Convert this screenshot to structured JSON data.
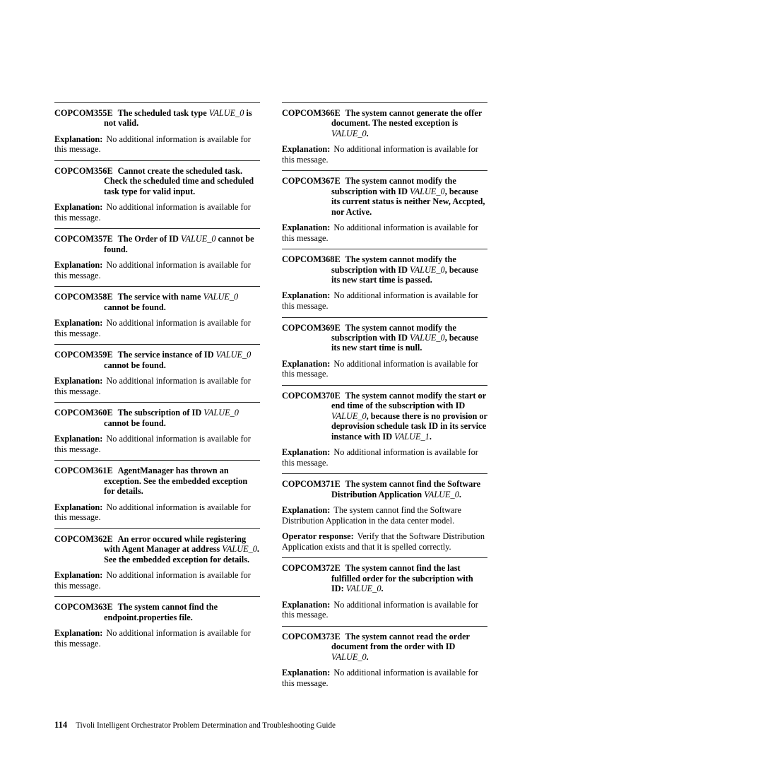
{
  "page": {
    "number": "114",
    "footer_title": "Tivoli Intelligent Orchestrator Problem Determination and Troubleshooting Guide"
  },
  "labels": {
    "explanation": "Explanation:",
    "operator_response": "Operator response:"
  },
  "columns": {
    "left": [
      {
        "id": "COPCOM355E",
        "text_parts": [
          {
            "t": "The scheduled task type ",
            "style": "bold"
          },
          {
            "t": "VALUE_0",
            "style": "var"
          },
          {
            "t": " is not valid.",
            "style": "bold"
          }
        ],
        "blocks": [
          {
            "label": "Explanation:",
            "body": "No additional information is available for this message."
          }
        ]
      },
      {
        "id": "COPCOM356E",
        "text_parts": [
          {
            "t": "Cannot create the scheduled task. Check the scheduled time and scheduled task type for valid input.",
            "style": "bold"
          }
        ],
        "blocks": [
          {
            "label": "Explanation:",
            "body": "No additional information is available for this message."
          }
        ]
      },
      {
        "id": "COPCOM357E",
        "text_parts": [
          {
            "t": "The Order of ID ",
            "style": "bold"
          },
          {
            "t": "VALUE_0",
            "style": "var"
          },
          {
            "t": " cannot be found.",
            "style": "bold"
          }
        ],
        "blocks": [
          {
            "label": "Explanation:",
            "body": "No additional information is available for this message."
          }
        ]
      },
      {
        "id": "COPCOM358E",
        "text_parts": [
          {
            "t": "The service with name ",
            "style": "bold"
          },
          {
            "t": "VALUE_0",
            "style": "var"
          },
          {
            "t": " cannot be found.",
            "style": "bold"
          }
        ],
        "blocks": [
          {
            "label": "Explanation:",
            "body": "No additional information is available for this message."
          }
        ]
      },
      {
        "id": "COPCOM359E",
        "text_parts": [
          {
            "t": "The service instance of ID ",
            "style": "bold"
          },
          {
            "t": "VALUE_0",
            "style": "var"
          },
          {
            "t": " cannot be found.",
            "style": "bold"
          }
        ],
        "blocks": [
          {
            "label": "Explanation:",
            "body": "No additional information is available for this message."
          }
        ]
      },
      {
        "id": "COPCOM360E",
        "text_parts": [
          {
            "t": "The subscription of ID ",
            "style": "bold"
          },
          {
            "t": "VALUE_0",
            "style": "var"
          },
          {
            "t": " cannot be found.",
            "style": "bold"
          }
        ],
        "blocks": [
          {
            "label": "Explanation:",
            "body": "No additional information is available for this message."
          }
        ]
      },
      {
        "id": "COPCOM361E",
        "text_parts": [
          {
            "t": "AgentManager has thrown an exception. See the embedded exception for details.",
            "style": "bold"
          }
        ],
        "blocks": [
          {
            "label": "Explanation:",
            "body": "No additional information is available for this message."
          }
        ]
      },
      {
        "id": "COPCOM362E",
        "text_parts": [
          {
            "t": "An error occured while registering with Agent Manager at address ",
            "style": "bold"
          },
          {
            "t": "VALUE_0",
            "style": "var"
          },
          {
            "t": ". See the embedded exception for details.",
            "style": "bold"
          }
        ],
        "blocks": [
          {
            "label": "Explanation:",
            "body": "No additional information is available for this message."
          }
        ]
      },
      {
        "id": "COPCOM363E",
        "text_parts": [
          {
            "t": "The system cannot find the endpoint.properties file.",
            "style": "bold"
          }
        ],
        "blocks": [
          {
            "label": "Explanation:",
            "body": "No additional information is available for this message."
          }
        ]
      }
    ],
    "right": [
      {
        "id": "COPCOM366E",
        "text_parts": [
          {
            "t": "The system cannot generate the offer document. The nested exception is ",
            "style": "bold"
          },
          {
            "t": "VALUE_0",
            "style": "var"
          },
          {
            "t": ".",
            "style": "bold"
          }
        ],
        "blocks": [
          {
            "label": "Explanation:",
            "body": "No additional information is available for this message."
          }
        ]
      },
      {
        "id": "COPCOM367E",
        "text_parts": [
          {
            "t": "The system cannot modify the subscription with ID ",
            "style": "bold"
          },
          {
            "t": "VALUE_0",
            "style": "var"
          },
          {
            "t": ", because its current status is neither New, Accpted, nor Active.",
            "style": "bold"
          }
        ],
        "blocks": [
          {
            "label": "Explanation:",
            "body": "No additional information is available for this message."
          }
        ]
      },
      {
        "id": "COPCOM368E",
        "text_parts": [
          {
            "t": "The system cannot modify the subscription with ID ",
            "style": "bold"
          },
          {
            "t": "VALUE_0",
            "style": "var"
          },
          {
            "t": ", because its new start time is passed.",
            "style": "bold"
          }
        ],
        "blocks": [
          {
            "label": "Explanation:",
            "body": "No additional information is available for this message."
          }
        ]
      },
      {
        "id": "COPCOM369E",
        "text_parts": [
          {
            "t": "The system cannot modify the subscription with ID ",
            "style": "bold"
          },
          {
            "t": "VALUE_0",
            "style": "var"
          },
          {
            "t": ", because its new start time is null.",
            "style": "bold"
          }
        ],
        "blocks": [
          {
            "label": "Explanation:",
            "body": "No additional information is available for this message."
          }
        ]
      },
      {
        "id": "COPCOM370E",
        "text_parts": [
          {
            "t": "The system cannot modify the start or end time of the subscription with ID ",
            "style": "bold"
          },
          {
            "t": "VALUE_0",
            "style": "var"
          },
          {
            "t": ", because there is no provision or deprovision schedule task ID in its service instance with ID ",
            "style": "bold"
          },
          {
            "t": "VALUE_1",
            "style": "var"
          },
          {
            "t": ".",
            "style": "bold"
          }
        ],
        "blocks": [
          {
            "label": "Explanation:",
            "body": "No additional information is available for this message."
          }
        ]
      },
      {
        "id": "COPCOM371E",
        "text_parts": [
          {
            "t": "The system cannot find the Software Distribution Application ",
            "style": "bold"
          },
          {
            "t": "VALUE_0",
            "style": "var"
          },
          {
            "t": ".",
            "style": "bold"
          }
        ],
        "blocks": [
          {
            "label": "Explanation:",
            "body": "The system cannot find the Software Distribution Application in the data center model."
          },
          {
            "label": "Operator response:",
            "body": "Verify that the Software Distribution Application exists and that it is spelled correctly."
          }
        ]
      },
      {
        "id": "COPCOM372E",
        "text_parts": [
          {
            "t": "The system cannot find the last fulfilled order for the subcription with ID: ",
            "style": "bold"
          },
          {
            "t": "VALUE_0",
            "style": "var"
          },
          {
            "t": ".",
            "style": "bold"
          }
        ],
        "blocks": [
          {
            "label": "Explanation:",
            "body": "No additional information is available for this message."
          }
        ]
      },
      {
        "id": "COPCOM373E",
        "text_parts": [
          {
            "t": "The system cannot read the order document from the order with ID ",
            "style": "bold"
          },
          {
            "t": "VALUE_0",
            "style": "var"
          },
          {
            "t": ".",
            "style": "bold"
          }
        ],
        "blocks": [
          {
            "label": "Explanation:",
            "body": "No additional information is available for this message."
          }
        ]
      }
    ]
  }
}
